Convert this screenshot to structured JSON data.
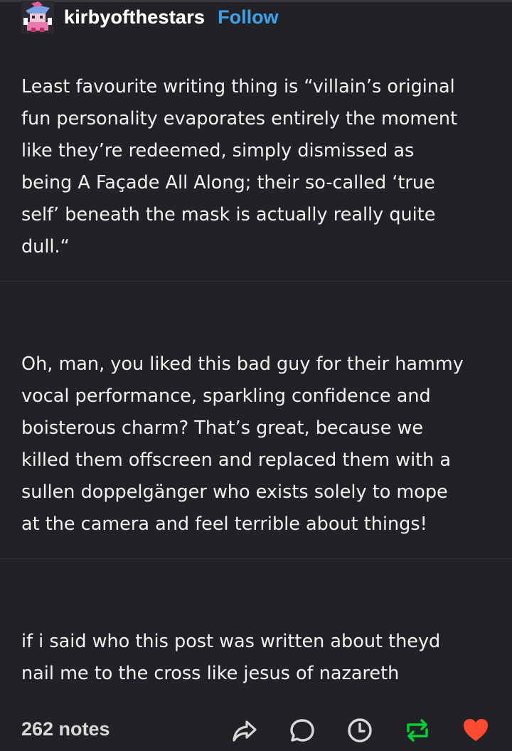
{
  "posts": [
    {
      "username": "kirbyofthestars",
      "follow_label": "Follow",
      "text": "Least favourite writing thing is “villain’s original\nfun personality evaporates entirely the moment\nlike they’re redeemed, simply dismissed as\nbeing A Façade All Along; their so-called ‘true\nself’ beneath the mask is actually really quite\ndull.“"
    },
    {
      "username": "kirbyofthestars",
      "follow_label": "Follow",
      "text": "Oh, man, you liked this bad guy for their hammy\nvocal performance, sparkling confidence and\nboisterous charm? That’s great, because we\nkilled them offscreen and replaced them with a\nsullen doppelgänger who exists solely to mope\nat the camera and feel terrible about things!"
    },
    {
      "username": "kirbyofthestars",
      "text": "if i said who this post was written about theyd\nnail me to the cross like jesus of nazareth"
    }
  ],
  "footer": {
    "notes": "262 notes",
    "icons": [
      "share-icon",
      "reply-icon",
      "clock-icon",
      "reblog-icon",
      "heart-icon"
    ]
  },
  "colors": {
    "background": "#222226",
    "follow": "#3f9ee8",
    "reblog": "#00cf35",
    "heart": "#ff4930"
  }
}
